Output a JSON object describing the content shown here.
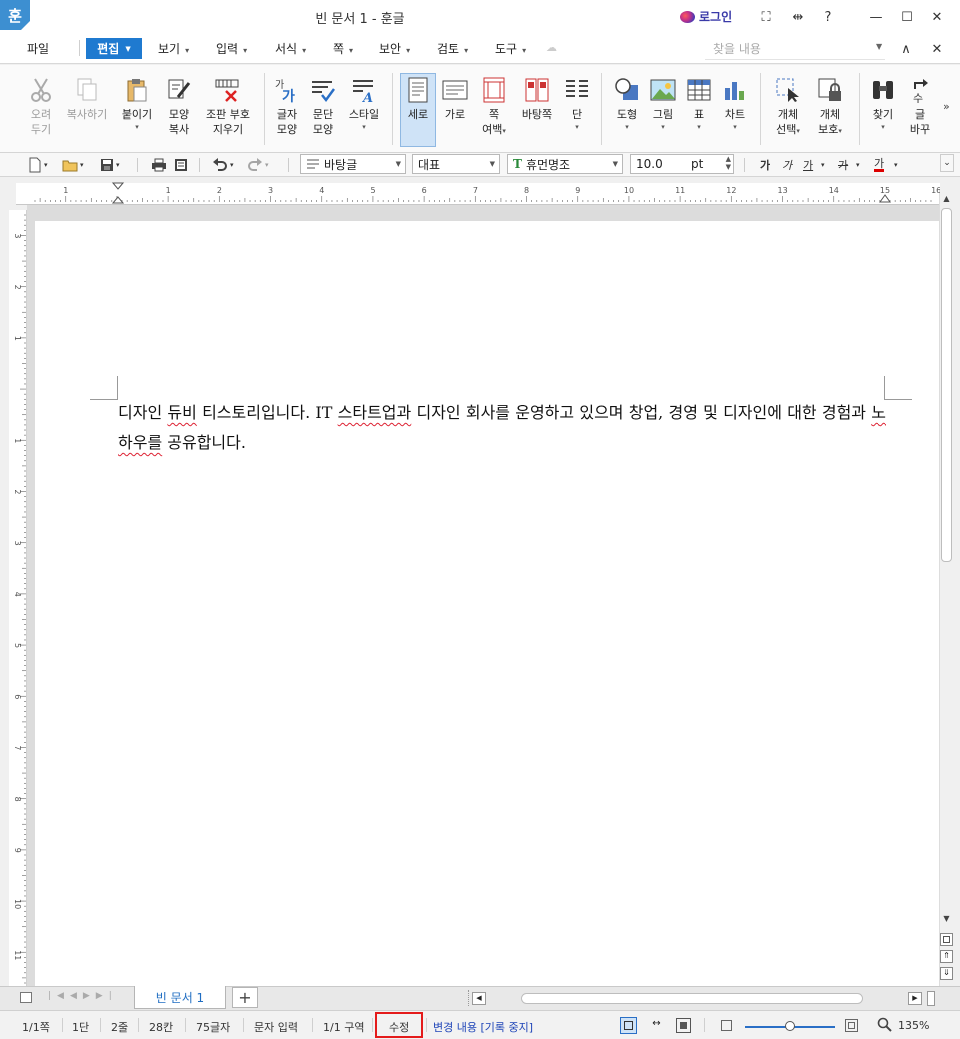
{
  "app": {
    "logo_glyph": "훈",
    "title": "빈 문서 1 - 훈글",
    "login": "로그인"
  },
  "window_controls": {
    "fullscreen_glyph": "⛶",
    "layout_glyph": "⇹",
    "help_glyph": "?",
    "minimize_glyph": "—",
    "maximize_glyph": "☐",
    "close_glyph": "✕"
  },
  "menu": {
    "file": "파일",
    "edit": "편집",
    "items": [
      "보기",
      "입력",
      "서식",
      "쪽",
      "보안",
      "검토",
      "도구"
    ],
    "find_placeholder": "찾을 내용",
    "collapse_glyph": "∧",
    "close_glyph": "✕"
  },
  "ribbon": {
    "cut": [
      "오려",
      "두기"
    ],
    "copy": "복사하기",
    "paste": "붙이기",
    "format_copy": [
      "모양",
      "복사"
    ],
    "erase_code": [
      "조판 부호",
      "지우기"
    ],
    "char_shape": [
      "글자",
      "모양"
    ],
    "para_shape": [
      "문단",
      "모양"
    ],
    "style": "스타일",
    "vertical": "세로",
    "horizontal": "가로",
    "margin": [
      "쪽",
      "여백"
    ],
    "background_page": "바탕쪽",
    "column": "단",
    "shape": "도형",
    "picture": "그림",
    "table": "표",
    "chart": "차트",
    "select_obj": [
      "개체",
      "선택"
    ],
    "protect_obj": [
      "개체",
      "보호"
    ],
    "find": "찾기",
    "replace": [
      "글",
      "바꾸"
    ],
    "more_glyph": "»"
  },
  "format_bar": {
    "style_name": "바탕글",
    "font_lang": "대표",
    "font_name": "휴먼명조",
    "font_size": "10.0",
    "size_unit": "pt",
    "bold": "가",
    "italic": "가",
    "underline": "가",
    "strike": "가",
    "color": "가"
  },
  "ruler": {
    "h_labels": [
      "1",
      "1",
      "2",
      "3",
      "4",
      "5",
      "6",
      "7",
      "8",
      "9",
      "10",
      "11",
      "12",
      "13",
      "14",
      "15",
      "16"
    ],
    "v_labels": [
      "3",
      "2",
      "1",
      "1",
      "2",
      "3",
      "4",
      "5",
      "6",
      "7",
      "8",
      "9",
      "10",
      "11"
    ]
  },
  "document": {
    "segments": [
      {
        "text": "디자인 ",
        "err": false
      },
      {
        "text": "듀비",
        "err": true
      },
      {
        "text": " 티스토리입니다. IT ",
        "err": false
      },
      {
        "text": "스타트업과",
        "err": true
      },
      {
        "text": " 디자인 회사를 운영하고 있으며 창업, 경영 및 디자인에 대한 경험과 ",
        "err": false
      },
      {
        "text": "노하우를",
        "err": true
      },
      {
        "text": " 공유합니다.",
        "err": false
      }
    ]
  },
  "tabs": {
    "doc_tab": "빈 문서 1",
    "add_glyph": "+"
  },
  "status": {
    "page": "1/1쪽",
    "column": "1단",
    "line": "2줄",
    "col": "28칸",
    "chars": "75글자",
    "mode": "문자 입력",
    "section": "1/1 구역",
    "edit": "수정",
    "track": "변경 내용 [기록 중지]",
    "zoom": "135%",
    "zoom_fraction": 0.5
  },
  "colors": {
    "accent": "#1f7ad0",
    "status_highlight": "#e41b1b",
    "track_text": "#1f45b8"
  }
}
